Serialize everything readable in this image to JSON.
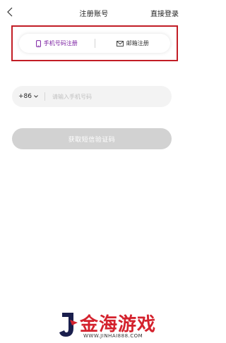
{
  "header": {
    "back_icon": "chevron-left-icon",
    "title": "注册账号",
    "direct_login": "直接登录"
  },
  "tabs": [
    {
      "label": "手机号码注册",
      "icon": "phone-icon",
      "active": true
    },
    {
      "label": "邮箱注册",
      "icon": "mail-icon",
      "active": false
    }
  ],
  "phone_form": {
    "country_code": "+86",
    "dropdown_icon": "chevron-down-icon",
    "placeholder": "请输入手机号码",
    "value": ""
  },
  "submit": {
    "label": "获取短信验证码",
    "enabled": false
  },
  "watermark": {
    "text": "金海游戏",
    "url": "WWW.JINHAI888.COM",
    "color": "#d4222d"
  },
  "colors": {
    "active_tab": "#7b1fa2",
    "highlight_border": "#c21d25",
    "disabled_button": "#d2d2d2"
  }
}
